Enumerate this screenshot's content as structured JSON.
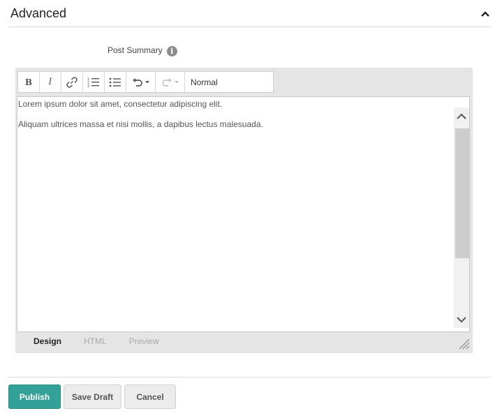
{
  "section": {
    "title": "Advanced"
  },
  "field": {
    "label": "Post Summary",
    "info_glyph": "i"
  },
  "toolbar": {
    "format_value": "Normal",
    "buttons": [
      {
        "icon": "bold-icon",
        "glyph": "B"
      },
      {
        "icon": "italic-icon",
        "glyph": "I"
      },
      {
        "icon": "link-icon"
      },
      {
        "icon": "ordered-list-icon"
      },
      {
        "icon": "unordered-list-icon"
      },
      {
        "icon": "undo-icon"
      },
      {
        "icon": "redo-icon"
      }
    ]
  },
  "editor": {
    "paragraphs": [
      "Lorem ipsum dolor sit amet, consectetur adipiscing elit.",
      "Aliquam ultrices massa et nisi mollis, a dapibus lectus malesuada."
    ],
    "tabs": [
      {
        "label": "Design",
        "active": true
      },
      {
        "label": "HTML",
        "active": false
      },
      {
        "label": "Preview",
        "active": false
      }
    ]
  },
  "actions": {
    "publish": "Publish",
    "save_draft": "Save Draft",
    "cancel": "Cancel"
  },
  "colors": {
    "primary": "#33a197",
    "editor_chrome": "#e5e5e5",
    "scroll_thumb": "#cdcdcd"
  }
}
